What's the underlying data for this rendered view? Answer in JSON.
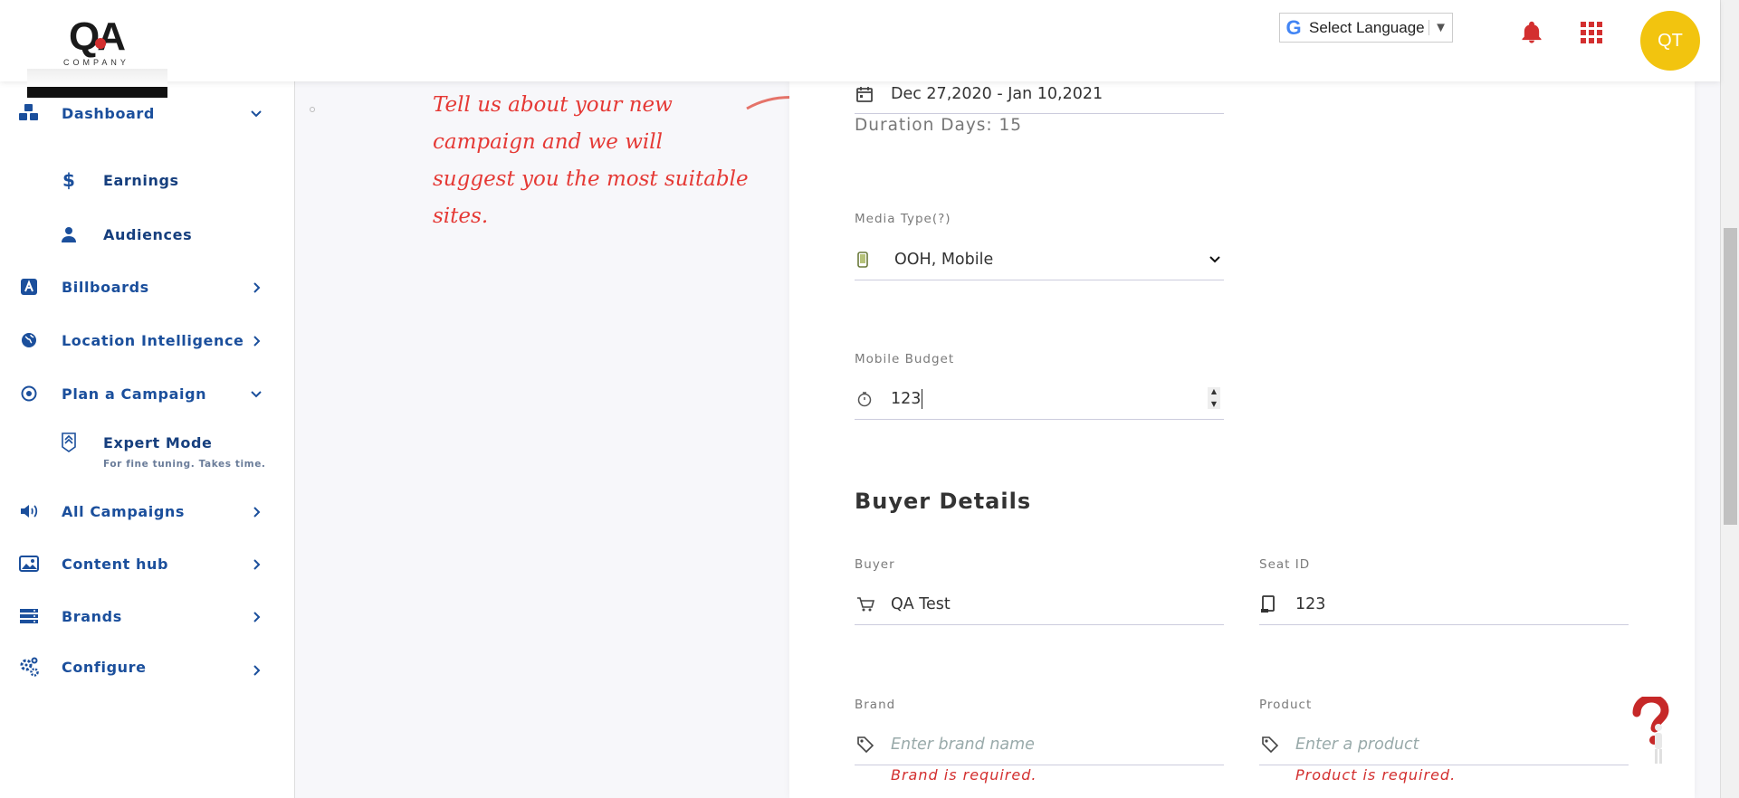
{
  "header": {
    "logo_text": "QA",
    "logo_sub": "COMPANY",
    "language_label": "Select Language",
    "language_arrow": "▼",
    "avatar_initials": "QT"
  },
  "sidebar": {
    "items": [
      {
        "label": "Dashboard",
        "icon": "cubes-icon",
        "expanded": true
      },
      {
        "label": "Earnings",
        "icon": "dollar-icon"
      },
      {
        "label": "Audiences",
        "icon": "person-icon"
      },
      {
        "label": "Billboards",
        "icon": "billboard-icon"
      },
      {
        "label": "Location Intelligence",
        "icon": "globe-icon"
      },
      {
        "label": "Plan a Campaign",
        "icon": "target-icon",
        "expanded": true
      },
      {
        "label": "Expert Mode",
        "icon": "expert-icon",
        "desc": "For fine tuning. Takes time."
      },
      {
        "label": "All Campaigns",
        "icon": "speaker-icon"
      },
      {
        "label": "Content hub",
        "icon": "image-icon"
      },
      {
        "label": "Brands",
        "icon": "list-icon"
      },
      {
        "label": "Configure",
        "icon": "cogs-icon"
      }
    ]
  },
  "hint": {
    "text": "Tell us about your new campaign and we will suggest you the most suitable sites."
  },
  "form": {
    "date_range": "Dec 27,2020 - Jan 10,2021",
    "duration": "Duration Days: 15",
    "media_type_label": "Media Type(?)",
    "media_type_value": "OOH, Mobile",
    "mobile_budget_label": "Mobile Budget",
    "mobile_budget_value": "123",
    "buyer_section_title": "Buyer Details",
    "buyer_label": "Buyer",
    "buyer_value": "QA Test",
    "seat_label": "Seat ID",
    "seat_value": "123",
    "brand_label": "Brand",
    "brand_placeholder": "Enter brand name",
    "brand_error": "Brand is required.",
    "product_label": "Product",
    "product_placeholder": "Enter a product",
    "product_error": "Product is required."
  },
  "colors": {
    "accent": "#1b4f9c",
    "error": "#d32f2f",
    "avatar": "#f2c40f"
  }
}
